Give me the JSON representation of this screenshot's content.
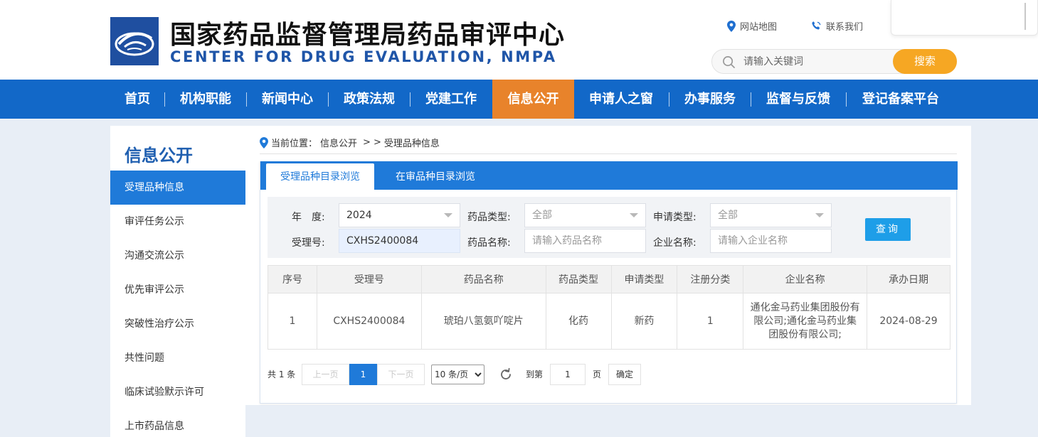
{
  "header": {
    "title_cn": "国家药品监督管理局药品审评中心",
    "title_en": "CENTER FOR DRUG EVALUATION, NMPA",
    "links": {
      "sitemap": "网站地图",
      "contact": "联系我们"
    },
    "search": {
      "placeholder": "请输入关键词",
      "button": "搜索"
    }
  },
  "nav": {
    "items": [
      "首页",
      "机构职能",
      "新闻中心",
      "政策法规",
      "党建工作",
      "信息公开",
      "申请人之窗",
      "办事服务",
      "监督与反馈",
      "登记备案平台"
    ],
    "active": "信息公开"
  },
  "sidebar": {
    "title": "信息公开",
    "items": [
      "受理品种信息",
      "审评任务公示",
      "沟通交流公示",
      "优先审评公示",
      "突破性治疗公示",
      "共性问题",
      "临床试验默示许可",
      "上市药品信息"
    ],
    "active": "受理品种信息"
  },
  "breadcrumb": {
    "prefix": "当前位置：",
    "level1": "信息公开",
    "sep": ">",
    "current": "受理品种信息"
  },
  "tabs": [
    "受理品种目录浏览",
    "在审品种目录浏览"
  ],
  "filters": {
    "year_label": "年　度:",
    "year_value": "2024",
    "accept_no_label": "受理号:",
    "accept_no_value": "CXHS2400084",
    "drug_type_label": "药品类型:",
    "drug_type_value": "全部",
    "drug_name_label": "药品名称:",
    "drug_name_placeholder": "请输入药品名称",
    "apply_type_label": "申请类型:",
    "apply_type_value": "全部",
    "company_label": "企业名称:",
    "company_placeholder": "请输入企业名称",
    "query_button": "查询"
  },
  "table": {
    "headers": [
      "序号",
      "受理号",
      "药品名称",
      "药品类型",
      "申请类型",
      "注册分类",
      "企业名称",
      "承办日期"
    ],
    "rows": [
      [
        "1",
        "CXHS2400084",
        "琥珀八氢氨吖啶片",
        "化药",
        "新药",
        "1",
        "通化金马药业集团股份有限公司;通化金马药业集团股份有限公司;",
        "2024-08-29"
      ]
    ]
  },
  "pager": {
    "total": "共 1 条",
    "prev": "上一页",
    "current": "1",
    "next": "下一页",
    "page_size": "10 条/页",
    "goto_label": "到第",
    "goto_value": "1",
    "page_unit": "页",
    "confirm": "确定"
  },
  "colors": {
    "nav_blue": "#1268c8",
    "nav_active": "#e8832b",
    "accent_blue": "#1f7ad9",
    "search_orange": "#f6a723",
    "query_blue": "#1e9ee8"
  }
}
